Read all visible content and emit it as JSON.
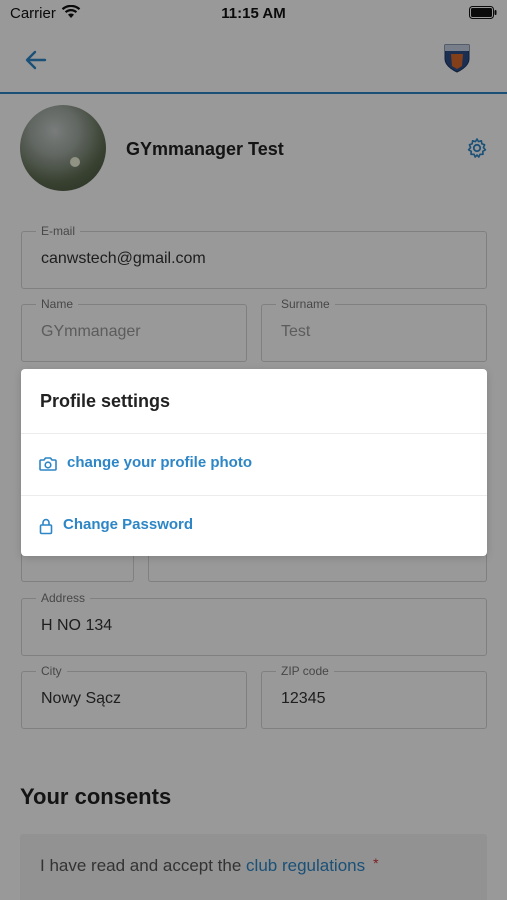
{
  "status_bar": {
    "carrier": "Carrier",
    "time": "11:15 AM"
  },
  "nav": {
    "back_icon": "arrow-left-icon",
    "logo_icon": "club-logo-icon",
    "accent": "#2d86c6"
  },
  "profile": {
    "name": "GYmmanager Test",
    "settings_icon": "gear-icon"
  },
  "form": {
    "email": {
      "label": "E-mail",
      "value": "canwstech@gmail.com"
    },
    "name": {
      "label": "Name",
      "value": "GYmmanager"
    },
    "surname": {
      "label": "Surname",
      "value": "Test"
    },
    "address": {
      "label": "Address",
      "value": "H NO 134"
    },
    "city": {
      "label": "City",
      "value": "Nowy Sącz"
    },
    "zip": {
      "label": "ZIP code",
      "value": "12345"
    }
  },
  "consents": {
    "title": "Your consents",
    "item_text": "I have read and accept the ",
    "item_link": "club regulations",
    "required_mark": "*"
  },
  "modal": {
    "title": "Profile settings",
    "options": [
      {
        "icon": "camera-icon",
        "label": "change your profile photo"
      },
      {
        "icon": "lock-icon",
        "label": "Change Password"
      }
    ]
  }
}
